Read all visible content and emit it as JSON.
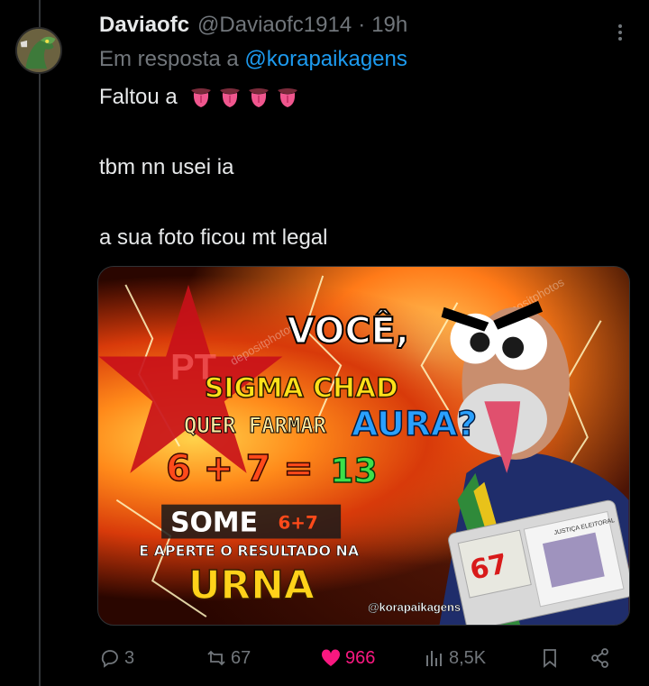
{
  "tweet": {
    "author_name": "Daviaofc",
    "author_handle": "@Daviaofc1914",
    "separator": "·",
    "time": "19h",
    "reply_prefix": "Em resposta a",
    "reply_handle": "@korapaikagens",
    "line1": "Faltou a",
    "line2": "tbm nn usei ia",
    "line3": "a sua foto ficou mt legal",
    "emoji_name": "tongue-emoji"
  },
  "media": {
    "watermark1": "depositphotos",
    "watermark2": "depositphotos",
    "pt": "PT",
    "voce": "VOCÊ,",
    "sigma": "SIGMA CHAD",
    "quer": "QUER FARMAR",
    "aura": "AURA?",
    "equation_left": "6 + 7 =",
    "equation_right": "13",
    "some": "SOME",
    "some_sub": "6+7",
    "aperte": "E APERTE O RESULTADO NA",
    "urna": "URNA",
    "credit": "@korapaikagens",
    "urna_number": "67",
    "urna_label": "JUSTIÇA ELEITORAL"
  },
  "actions": {
    "replies": "3",
    "retweets": "67",
    "likes": "966",
    "views": "8,5K",
    "like_color": "#f91880"
  },
  "colors": {
    "background": "#000000",
    "text": "#e7e9ea",
    "muted": "#71767b",
    "link": "#1d9bf0"
  }
}
